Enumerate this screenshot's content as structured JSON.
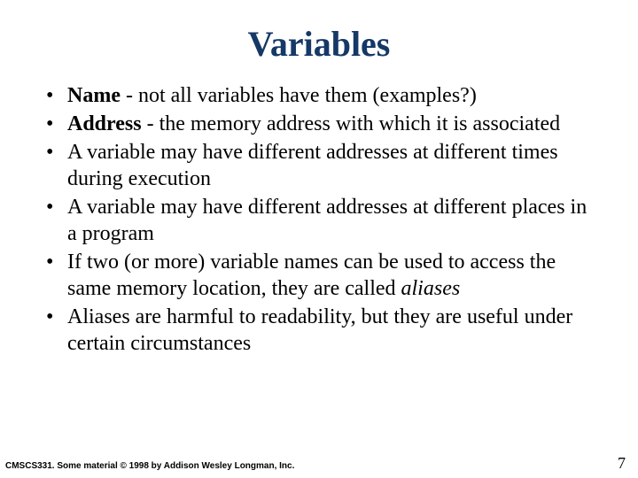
{
  "title": "Variables",
  "bullets": [
    {
      "lead": "Name",
      "lead_style": "b",
      "rest": " - not all variables have them (examples?)"
    },
    {
      "lead": "Address",
      "lead_style": "b",
      "rest": " - the memory address with which it is associated"
    },
    {
      "lead": "",
      "lead_style": "",
      "rest": "A variable may have different addresses at different times during execution"
    },
    {
      "lead": "",
      "lead_style": "",
      "rest": "A variable may have different addresses at different places in a program"
    },
    {
      "lead": "",
      "lead_style": "",
      "rest_pre": "If two (or more) variable names can be used to access the same memory location, they are called ",
      "rest_em": "aliases",
      "rest_post": ""
    },
    {
      "lead": "",
      "lead_style": "",
      "rest": "Aliases are harmful to readability, but they are useful under certain circumstances"
    }
  ],
  "footer_left": "CMSCS331. Some material © 1998 by Addison Wesley Longman, Inc.",
  "page_number": "7"
}
